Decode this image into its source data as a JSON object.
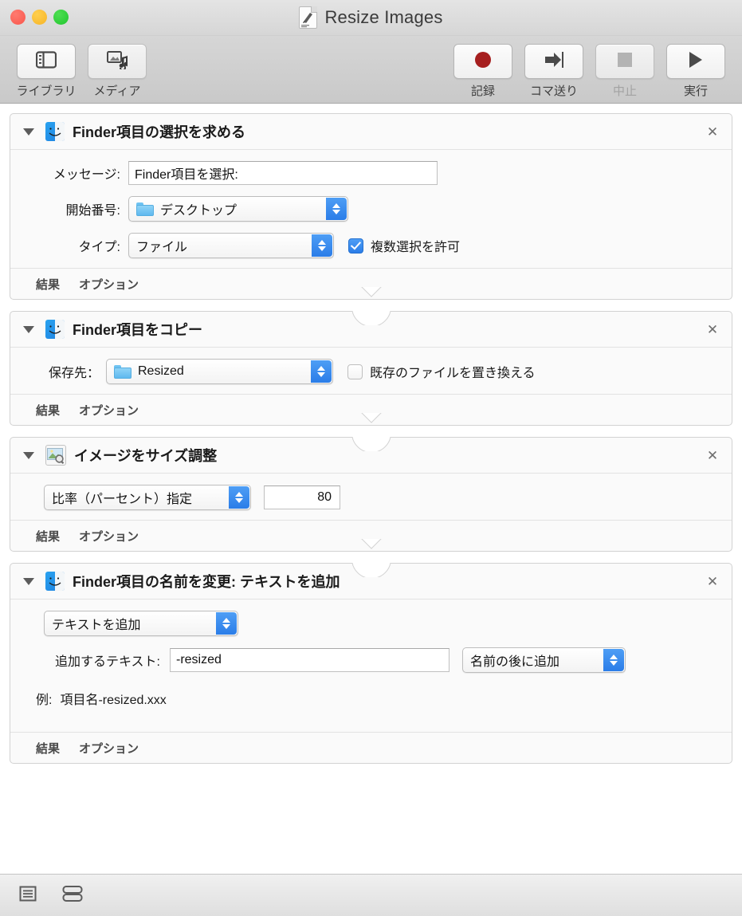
{
  "window": {
    "title": "Resize Images",
    "doc_icon": "automator-workflow-document-icon",
    "traffic_lights": [
      "close",
      "minimize",
      "maximize"
    ]
  },
  "toolbar": {
    "left_items": [
      {
        "label": "ライブラリ",
        "icon": "library-sidebar-icon",
        "enabled": true
      },
      {
        "label": "メディア",
        "icon": "media-photo-music-icon",
        "enabled": true
      }
    ],
    "right_items": [
      {
        "label": "記録",
        "icon": "record-circle-icon",
        "enabled": true
      },
      {
        "label": "コマ送り",
        "icon": "step-forward-icon",
        "enabled": true
      },
      {
        "label": "中止",
        "icon": "stop-square-icon",
        "enabled": false
      },
      {
        "label": "実行",
        "icon": "run-play-icon",
        "enabled": true
      }
    ]
  },
  "footer_links": {
    "results": "結果",
    "options": "オプション"
  },
  "close_glyph": "✕",
  "actions": [
    {
      "title": "Finder項目の選択を求める",
      "icon": "finder-icon",
      "rows": [
        {
          "type": "textfield",
          "label": "メッセージ:",
          "value": "Finder項目を選択:",
          "placeholder": ""
        },
        {
          "type": "popup_folder",
          "label": "開始番号:",
          "value": "デスクトップ",
          "folder_icon": "blue-folder-icon"
        },
        {
          "type": "popup_checkbox",
          "label": "タイプ:",
          "value": "ファイル",
          "checkbox_label": "複数選択を許可",
          "checked": true
        }
      ]
    },
    {
      "title": "Finder項目をコピー",
      "icon": "finder-icon",
      "rows": [
        {
          "type": "popup_folder_checkbox",
          "label": "保存先：",
          "value": "Resized",
          "folder_icon": "blue-folder-icon",
          "checkbox_label": "既存のファイルを置き換える",
          "checked": false
        }
      ]
    },
    {
      "title": "イメージをサイズ調整",
      "icon": "image-resize-icon",
      "rows": [
        {
          "type": "popup_number",
          "value": "比率（パーセント）指定",
          "number": "80"
        }
      ]
    },
    {
      "title": "Finder項目の名前を変更: テキストを追加",
      "icon": "finder-icon",
      "rows": [
        {
          "type": "popup_alone",
          "value": "テキストを追加"
        },
        {
          "type": "textfield_popup",
          "label": "追加するテキスト:",
          "value": "-resized",
          "popup_value": "名前の後に追加"
        },
        {
          "type": "example",
          "label": "例:",
          "value": "項目名-resized.xxx"
        }
      ]
    }
  ],
  "bottom_bar": {
    "buttons": [
      {
        "icon": "list-view-icon",
        "name": "log-view-button"
      },
      {
        "icon": "split-view-icon",
        "name": "split-view-button"
      }
    ]
  },
  "colors": {
    "accent_blue": "#2b7de8",
    "record_red": "#a61f1f",
    "titlebar": "#d6d6d6",
    "action_bg": "#fafafa"
  }
}
